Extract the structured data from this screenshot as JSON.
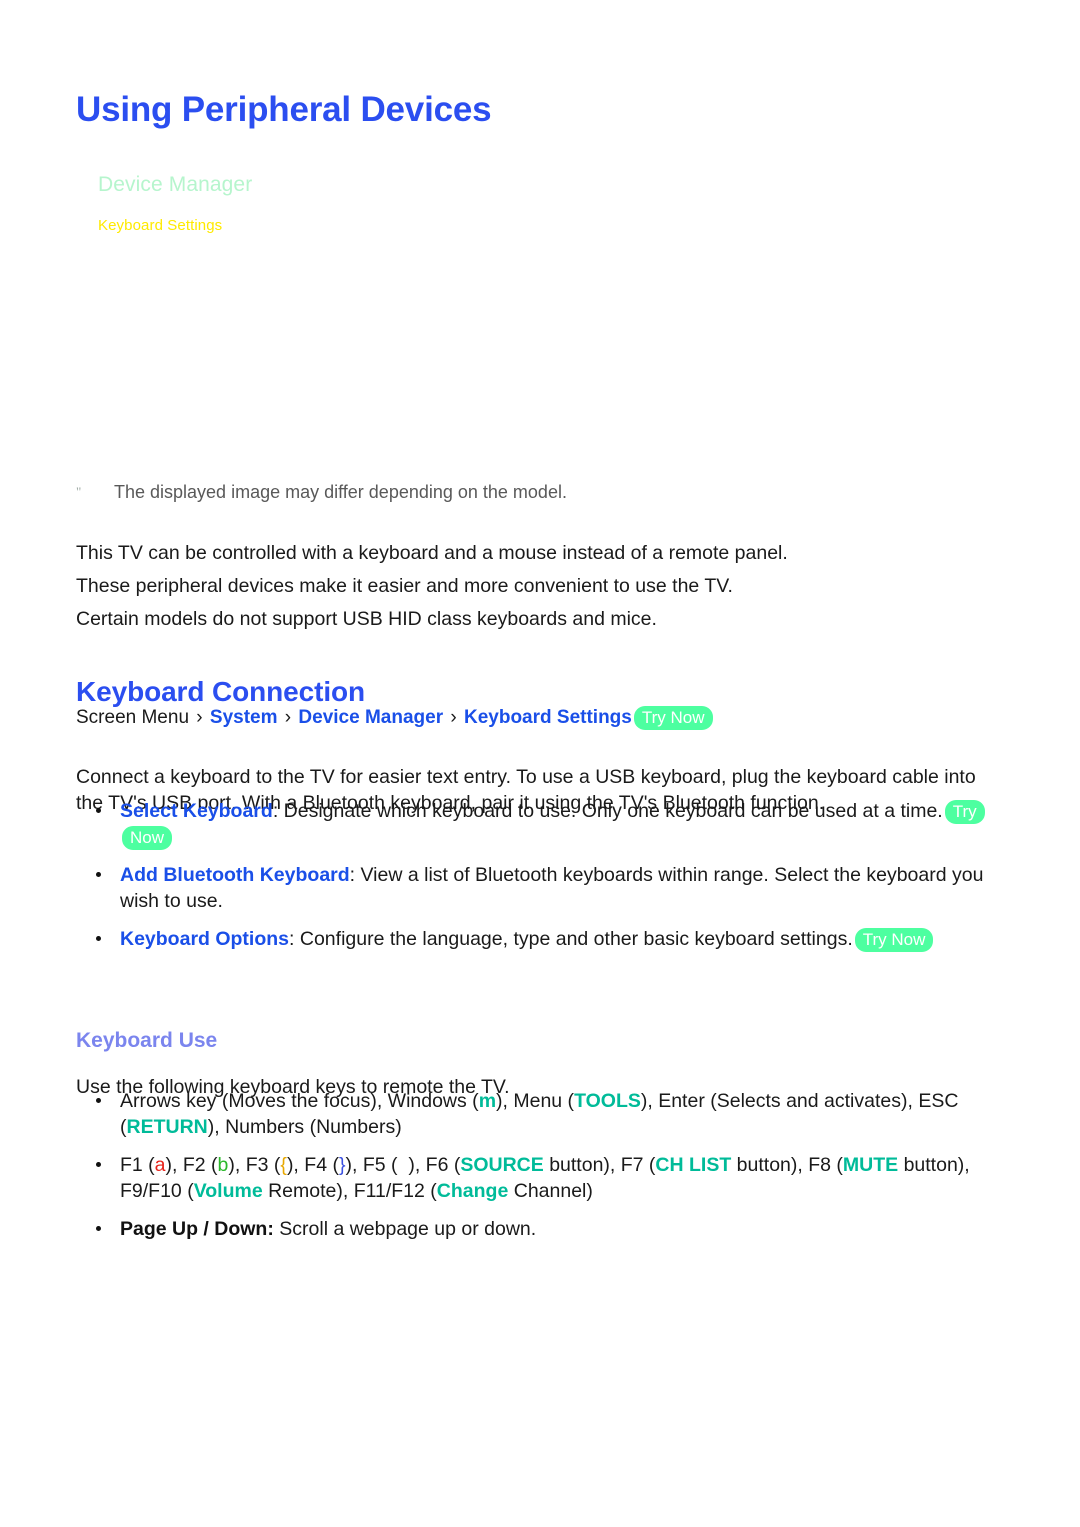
{
  "page": {
    "title": "Using Peripheral Devices"
  },
  "figure": {
    "menu_title": "Device Manager",
    "menu_item": "Keyboard Settings",
    "note_mark": "\"",
    "note_text": "The displayed image may differ depending on the model."
  },
  "intro_paragraphs": [
    "This TV can be controlled with a keyboard and a mouse instead of a remote panel.",
    "These peripheral devices make it easier and more convenient to use the TV.",
    "Certain models do not support USB HID class keyboards and mice."
  ],
  "keyboard_connection": {
    "heading": "Keyboard Connection",
    "breadcrumb": {
      "root": "Screen Menu",
      "sep": "›",
      "links": [
        "System",
        "Device Manager",
        "Keyboard Settings"
      ],
      "badge": "Try Now"
    },
    "intro": "Connect a keyboard to the TV for easier text entry. To use a USB keyboard, plug the keyboard cable into the TV's USB port. With a Bluetooth keyboard, pair it using the TV's Bluetooth function.",
    "items": [
      {
        "term": "Select Keyboard",
        "separator": ":",
        "description": "Designate which keyboard to use. Only one keyboard can be used at a time.",
        "badge": "Try Now"
      },
      {
        "term": "Add Bluetooth Keyboard",
        "separator": ":",
        "description": "View a list of Bluetooth keyboards within range. Select the keyboard you wish to use.",
        "badge": ""
      },
      {
        "term": "Keyboard Options",
        "separator": ":",
        "description": "Configure the language, type and other basic keyboard settings.",
        "badge": "Try Now"
      }
    ]
  },
  "keyboard_use": {
    "heading": "Keyboard Use",
    "intro": "Use the following keyboard keys to remote the TV.",
    "arrows_line": {
      "pre_windows": "Arrows key (Moves the focus), Windows (",
      "windows_glyph": "m",
      "post_windows": "), Menu (",
      "tools_key": "TOOLS",
      "post_tools": "), Enter (Selects and activates), ESC (",
      "return_key": "RETURN",
      "tail": "), Numbers (Numbers)"
    },
    "function_keys": {
      "f1_label": "F1 (",
      "f1_glyph": "a",
      "f1_close": "),",
      "f2_label": "F2 (",
      "f2_glyph": "b",
      "f2_close": "),",
      "f3_label": "F3 (",
      "f3_glyph": "{",
      "f3_close": "),",
      "f4_label": "F4 (",
      "f4_glyph": "}",
      "f4_close": "),",
      "f5_label": "F5 (",
      "f5_glyph": "",
      "f5_close": "),",
      "f6_label": "F6 (",
      "f6_key": "SOURCE",
      "f6_close": " button),",
      "f7_label": "F7 (",
      "f7_key": "CH LIST",
      "f7_close": " button),",
      "f8_label": "F8 (",
      "f8_key": "MUTE",
      "f8_close": " button),",
      "f9_label": "F9/F10 (",
      "f9_key": "Volume",
      "f9_close": " Remote),",
      "f11_label": "F11/F12 (",
      "f11_key": "Change",
      "f11_close": " Channel)"
    },
    "page_keys": {
      "term": "Page Up / Down",
      "separator": ":",
      "description": "Scroll a webpage up or down."
    }
  },
  "colors": {
    "heading_blue": "#2b4ef0",
    "link_blue": "#1a4fe8",
    "subheading_blue": "#7b85ee",
    "badge_green": "#4dffa0",
    "key_teal": "#00bb99",
    "menu_green": "#b6f5cd",
    "menu_yellow": "#ffea00"
  }
}
